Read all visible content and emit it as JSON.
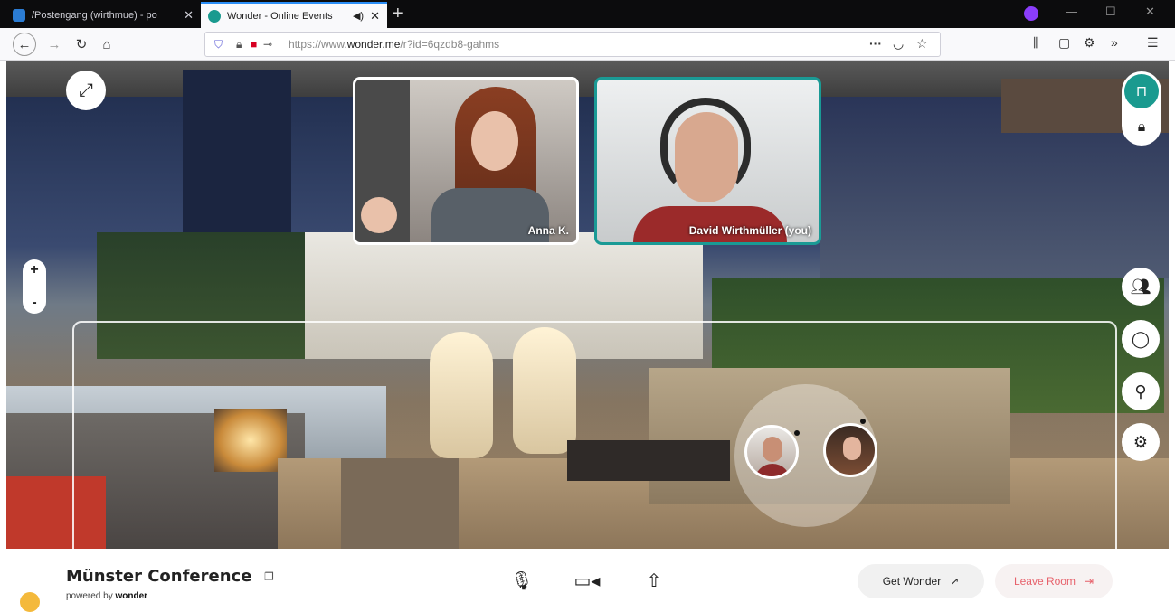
{
  "browser": {
    "tabs": [
      {
        "title": "/Postengang (wirthmue) - po",
        "active": false
      },
      {
        "title": "Wonder - Online Events",
        "active": true
      }
    ],
    "url_prefix": "https://www.",
    "url_domain": "wonder.me",
    "url_rest": "/r?id=6qzdb8-gahms",
    "url_menu": "···"
  },
  "room": {
    "video_tiles": [
      {
        "name": "Anna K."
      },
      {
        "name": "David Wirthmüller (you)"
      }
    ],
    "zoom_in": "+",
    "zoom_out": "-"
  },
  "footer": {
    "room_title": "Münster Conference",
    "powered_prefix": "powered by",
    "powered_brand": "wonder",
    "get_wonder_label": "Get Wonder",
    "leave_room_label": "Leave Room"
  },
  "colors": {
    "accent": "#1a9a8f",
    "leave": "#e7616b"
  }
}
